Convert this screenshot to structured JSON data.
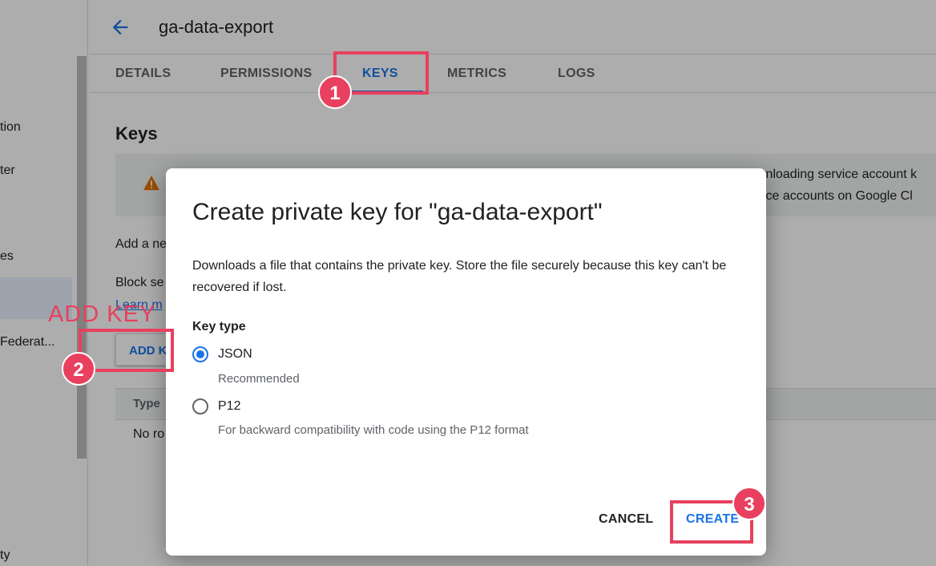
{
  "header": {
    "title": "ga-data-export",
    "back_icon": "arrow-left-icon"
  },
  "tabs": [
    {
      "label": "DETAILS"
    },
    {
      "label": "PERMISSIONS"
    },
    {
      "label": "KEYS",
      "active": true
    },
    {
      "label": "METRICS"
    },
    {
      "label": "LOGS"
    }
  ],
  "left_nav": [
    "tion",
    "ter",
    "es",
    "Federat...",
    "ty"
  ],
  "main": {
    "section_title": "Keys",
    "warning_lines": [
      "wnloading service account k",
      "vice accounts on Google Cl"
    ],
    "add_text": "Add a ne",
    "block_text": "Block se",
    "learn_link": "Learn m",
    "add_key_button": "ADD K",
    "table_header": "Type",
    "table_empty": "No ro"
  },
  "dialog": {
    "title": "Create private key for \"ga-data-export\"",
    "description": "Downloads a file that contains the private key. Store the file securely because this key can't be recovered if lost.",
    "key_type_label": "Key type",
    "options": [
      {
        "label": "JSON",
        "sublabel": "Recommended",
        "selected": true
      },
      {
        "label": "P12",
        "sublabel": "For backward compatibility with code using the P12 format",
        "selected": false
      }
    ],
    "cancel_label": "CANCEL",
    "create_label": "CREATE"
  },
  "annotations": {
    "badges": [
      "1",
      "2",
      "3"
    ],
    "add_key_caption": "ADD KEY",
    "color": "#e8405e"
  },
  "colors": {
    "accent": "#1a73e8",
    "annotation": "#e8405e",
    "warning": "#e37400"
  }
}
